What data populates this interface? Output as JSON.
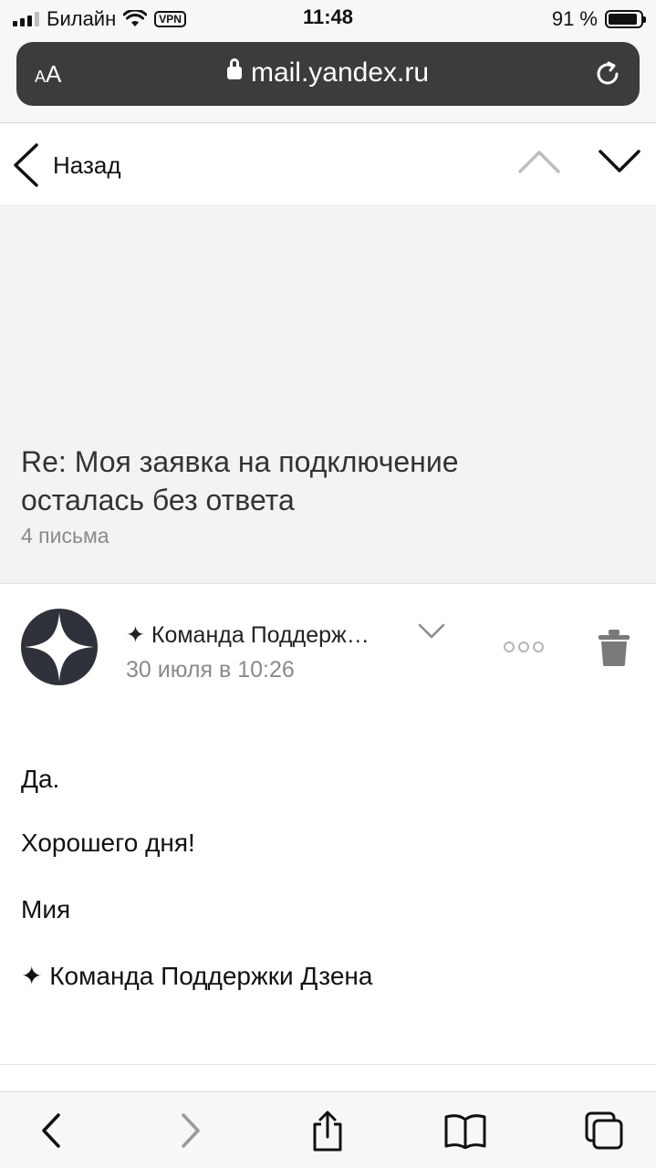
{
  "status_bar": {
    "carrier": "Билайн",
    "vpn": "VPN",
    "time": "11:48",
    "battery_text": "91 %",
    "battery_level": 0.91
  },
  "browser": {
    "text_size_label_small": "A",
    "text_size_label_large": "A",
    "url": "mail.yandex.ru"
  },
  "nav": {
    "back_label": "Назад"
  },
  "thread": {
    "subject": "Re: Моя заявка на подключение осталась без ответа",
    "count": "4 письма"
  },
  "message": {
    "sender": "✦ Команда Поддерж…",
    "date": "30 июля в 10:26",
    "body": [
      "Да.",
      "Хорошего дня!",
      "Мия",
      "✦ Команда Поддержки Дзена"
    ]
  },
  "icons": {
    "lock": "lock-icon",
    "reload": "reload-icon",
    "back": "chevron-left-icon",
    "prev": "chevron-up-icon",
    "next": "chevron-down-icon",
    "more": "more-dots-icon",
    "trash": "trash-icon",
    "share": "share-icon",
    "bookmarks": "book-icon",
    "tabs": "tabs-icon"
  },
  "colors": {
    "url_bar": "#3c3c3c",
    "subject_bg": "#f4f3f2",
    "avatar": "#30323b",
    "muted": "#8a8a8a"
  }
}
